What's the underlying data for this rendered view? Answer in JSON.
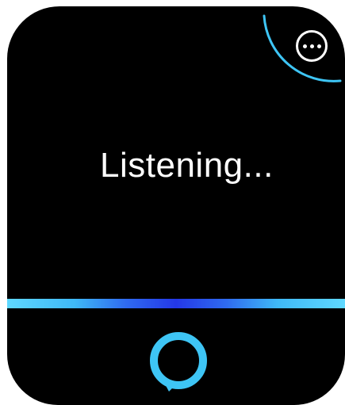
{
  "screen": {
    "status_text": "Listening...",
    "accent_color": "#3ec5f5",
    "bar_colors": [
      "#5fd8ff",
      "#2438e8"
    ]
  },
  "controls": {
    "more_icon": "more-horizontal-icon"
  },
  "branding": {
    "logo_icon": "alexa-logo-icon"
  }
}
